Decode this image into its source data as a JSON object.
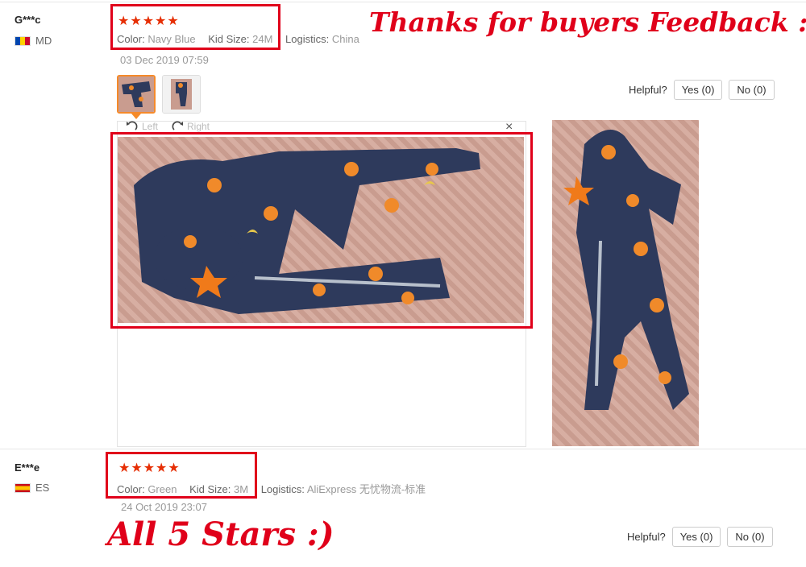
{
  "reviews": [
    {
      "user": "G***c",
      "country": "MD",
      "stars": "★★★★★",
      "attrs": [
        {
          "key": "Color:",
          "value": "Navy Blue"
        },
        {
          "key": "Kid Size:",
          "value": "24M"
        },
        {
          "key": "Logistics:",
          "value": "China"
        }
      ],
      "date": "03 Dec 2019 07:59",
      "helpful_label": "Helpful?",
      "yes_label": "Yes (0)",
      "no_label": "No (0)"
    },
    {
      "user": "E***e",
      "country": "ES",
      "stars": "★★★★★",
      "attrs": [
        {
          "key": "Color:",
          "value": "Green"
        },
        {
          "key": "Kid Size:",
          "value": "3M"
        },
        {
          "key": "Logistics:",
          "value": "AliExpress 无忧物流-标准"
        }
      ],
      "date": "24 Oct 2019 23:07",
      "helpful_label": "Helpful?",
      "yes_label": "Yes (0)",
      "no_label": "No (0)"
    }
  ],
  "viewer": {
    "left_label": "Left",
    "right_label": "Right",
    "close_glyph": "×"
  },
  "promo": {
    "top": "Thanks for buyers Feedback : )",
    "bottom": "All 5 Stars :)"
  },
  "colors": {
    "accent": "#e0001a",
    "star": "#e62e04",
    "garment": "#2e3a5c",
    "thumb_selected": "#f58a2a"
  },
  "icons": {
    "rotate_left": "rotate-left-icon",
    "rotate_right": "rotate-right-icon",
    "close": "close-icon"
  }
}
